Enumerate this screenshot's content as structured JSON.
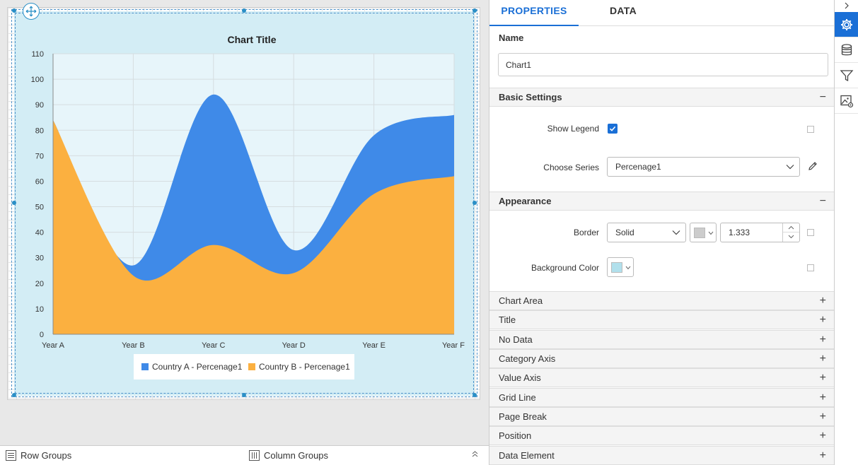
{
  "chart_data": {
    "type": "area",
    "title": "Chart Title",
    "categories": [
      "Year A",
      "Year B",
      "Year C",
      "Year D",
      "Year E",
      "Year F"
    ],
    "ylim": [
      0,
      110
    ],
    "yticks": [
      0,
      10,
      20,
      30,
      40,
      50,
      60,
      70,
      80,
      90,
      100,
      110
    ],
    "stacked": true,
    "series": [
      {
        "name": "Country A - Percenage1",
        "color": "#3f8ae8",
        "values": [
          0,
          4,
          59,
          9,
          23,
          24
        ]
      },
      {
        "name": "Country B - Percenage1",
        "color": "#fbb040",
        "values": [
          84,
          23,
          35,
          24,
          55,
          62
        ]
      }
    ],
    "legend_position": "bottom",
    "grid": true,
    "area_background": "#e7f5fa",
    "chart_background": "#d3edf5"
  },
  "tabs": {
    "properties": "PROPERTIES",
    "data": "DATA"
  },
  "name": {
    "label": "Name",
    "value": "Chart1"
  },
  "basic_settings": {
    "header": "Basic Settings",
    "toggle": "−",
    "show_legend_label": "Show Legend",
    "choose_series_label": "Choose Series",
    "choose_series_value": "Percenage1"
  },
  "appearance": {
    "header": "Appearance",
    "toggle": "−",
    "border_label": "Border",
    "border_style": "Solid",
    "border_color": "#cccccc",
    "border_width": "1.333",
    "background_color_label": "Background Color",
    "background_color": "#b1e0ec"
  },
  "collapsed_sections": [
    {
      "label": "Chart Area",
      "toggle": "+"
    },
    {
      "label": "Title",
      "toggle": "+"
    },
    {
      "label": "No Data",
      "toggle": "+"
    },
    {
      "label": "Category Axis",
      "toggle": "+"
    },
    {
      "label": "Value Axis",
      "toggle": "+"
    },
    {
      "label": "Grid Line",
      "toggle": "+"
    },
    {
      "label": "Page Break",
      "toggle": "+"
    },
    {
      "label": "Position",
      "toggle": "+"
    },
    {
      "label": "Data Element",
      "toggle": "+"
    }
  ],
  "group_bar": {
    "row_groups": "Row Groups",
    "column_groups": "Column Groups"
  },
  "icons": [
    "gear-icon",
    "database-icon",
    "filter-icon",
    "image-settings-icon",
    "chevron-right-icon"
  ],
  "accent_color": "#1a6fd6"
}
